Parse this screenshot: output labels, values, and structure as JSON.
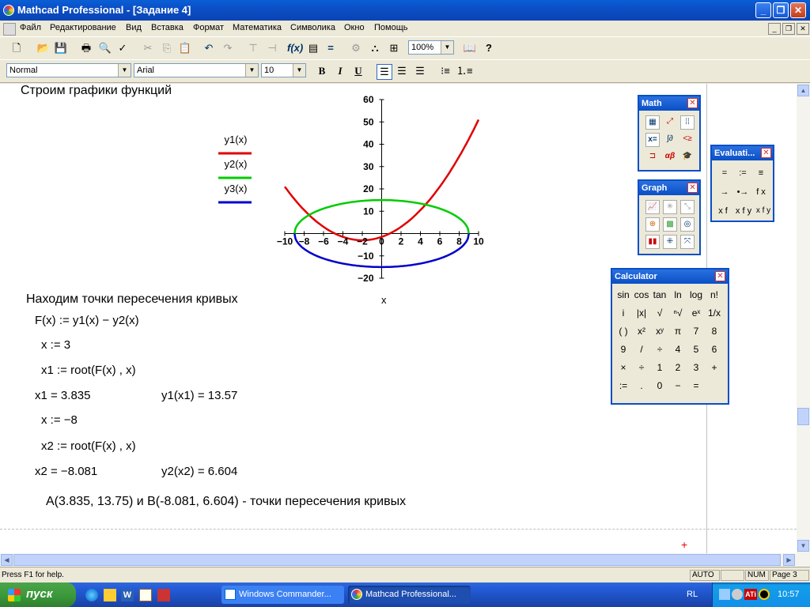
{
  "window": {
    "title": "Mathcad Professional - [Задание 4]"
  },
  "menu": [
    "Файл",
    "Редактирование",
    "Вид",
    "Вставка",
    "Формат",
    "Математика",
    "Символика",
    "Окно",
    "Помощь"
  ],
  "toolbar": {
    "zoom": "100%"
  },
  "format_bar": {
    "style": "Normal",
    "font": "Arial",
    "size": "10",
    "bold": "B",
    "italic": "I",
    "underline": "U"
  },
  "doc": {
    "heading": "Строим графики функций",
    "intersect_heading": "Находим точки пересечения кривых",
    "eq_F": "F(x) := y1(x) − y2(x)",
    "eq_x3": "x := 3",
    "eq_x1root": "x1 := root(F(x) , x)",
    "res_x1": "x1 = 3.835",
    "res_y1x1": "y1(x1) = 13.57",
    "eq_xm8": "x := −8",
    "eq_x2root": "x2 := root(F(x) , x)",
    "res_x2": "x2 = −8.081",
    "res_y2x2": "y2(x2) = 6.604",
    "conclusion": "A(3.835, 13.75) и B(-8.081, 6.604) - точки пересечения кривых",
    "plus_mark": "+"
  },
  "chart_data": {
    "type": "line",
    "xlabel": "x",
    "xlim": [
      -10,
      10
    ],
    "ylim": [
      -20,
      60
    ],
    "xticks": [
      -10,
      -8,
      -6,
      -4,
      -2,
      0,
      2,
      4,
      6,
      8,
      10
    ],
    "yticks": [
      -20,
      -10,
      10,
      20,
      30,
      40,
      50,
      60
    ],
    "series": [
      {
        "name": "y1(x)",
        "color": "#e00000",
        "x": [
          -10,
          -8,
          -6,
          -4,
          -2,
          0,
          2,
          4,
          6,
          8,
          10
        ],
        "y": [
          15,
          7.5,
          2,
          -1.5,
          -3,
          -1.5,
          4,
          14.5,
          26,
          40,
          55
        ]
      },
      {
        "name": "y2(x)",
        "color": "#00cc00",
        "x": [
          -9,
          -8,
          -6,
          -4,
          -2,
          0,
          2,
          4,
          6,
          8,
          9
        ],
        "y": [
          0,
          6.9,
          11.2,
          13.4,
          14.6,
          15,
          14.6,
          13.4,
          11.2,
          6.9,
          0
        ]
      },
      {
        "name": "y3(x)",
        "color": "#0000cc",
        "x": [
          -9,
          -8,
          -6,
          -4,
          -2,
          0,
          2,
          4,
          6,
          8,
          9
        ],
        "y": [
          0,
          -6.9,
          -11.2,
          -13.4,
          -14.6,
          -15,
          -14.6,
          -13.4,
          -11.2,
          -6.9,
          0
        ]
      }
    ],
    "grid": false,
    "legend": "left"
  },
  "palettes": {
    "math": {
      "title": "Math",
      "icons": [
        "calculator-icon",
        "graph-icon",
        "matrix-icon",
        "evaluation-icon",
        "calculus-icon",
        "boolean-icon",
        "programming-icon",
        "greek-icon",
        "symbolic-icon"
      ]
    },
    "graph": {
      "title": "Graph",
      "icons": [
        "xy-plot-icon",
        "polar-plot-icon",
        "surface-plot-icon",
        "contour-plot-icon",
        "3d-scatter-icon",
        "3d-bar-icon",
        "vector-field-icon",
        "trace-icon",
        "zoom-icon"
      ]
    },
    "evaluation": {
      "title": "Evaluati...",
      "buttons": [
        "=",
        ":=",
        "≡",
        "→",
        "•→",
        "f x",
        "x f",
        "x f y",
        "x f y"
      ]
    },
    "calculator": {
      "title": "Calculator",
      "buttons": [
        "sin",
        "cos",
        "tan",
        "ln",
        "log",
        "n!",
        "i",
        "|x|",
        "√",
        "ⁿ√",
        "eˣ",
        "1/x",
        "( )",
        "x²",
        "xʸ",
        "π",
        "7",
        "8",
        "9",
        "/",
        "÷",
        "4",
        "5",
        "6",
        "×",
        "÷",
        "1",
        "2",
        "3",
        "+",
        ":=",
        ".",
        "0",
        "−",
        "="
      ]
    }
  },
  "status": {
    "help": "Press F1 for help.",
    "mode": "AUTO",
    "num": "NUM",
    "page": "Page 3"
  },
  "taskbar": {
    "start": "пуск",
    "tasks": [
      "Windows Commander...",
      "Mathcad Professional..."
    ],
    "lang": "RL",
    "clock": "10:57"
  }
}
